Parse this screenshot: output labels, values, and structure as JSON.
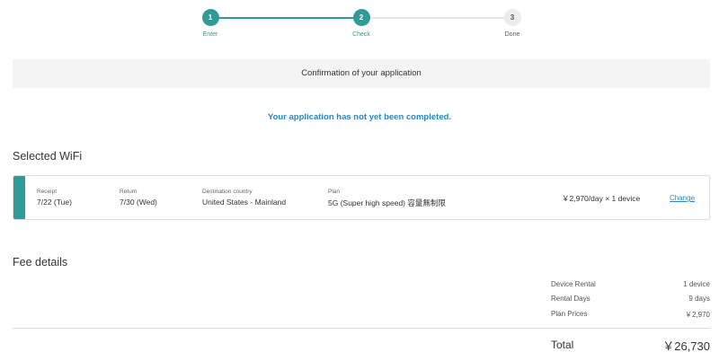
{
  "stepper": {
    "steps": [
      {
        "number": "1",
        "label": "Enter",
        "state": "active"
      },
      {
        "number": "2",
        "label": "Check",
        "state": "active"
      },
      {
        "number": "3",
        "label": "Done",
        "state": "inactive"
      }
    ]
  },
  "banner": {
    "text": "Confirmation of your application"
  },
  "warning": {
    "text": "Your application has not yet been completed."
  },
  "selected_wifi": {
    "title": "Selected WiFi",
    "receipt": {
      "label": "Receipt",
      "value": "7/22 (Tue)"
    },
    "return": {
      "label": "Return",
      "value": "7/30 (Wed)"
    },
    "destination": {
      "label": "Destination country",
      "value": "United States - Mainland"
    },
    "plan": {
      "label": "Plan",
      "value": "5G (Super high speed) 容量無制限"
    },
    "price": "￥2,970/day × 1 device",
    "change_label": "Change"
  },
  "fee_details": {
    "title": "Fee details",
    "rows": [
      {
        "label": "Device Rental",
        "value": "1 device"
      },
      {
        "label": "Rental Days",
        "value": "9 days"
      },
      {
        "label": "Plan Prices",
        "value": "￥2,970"
      }
    ],
    "total_label": "Total",
    "total_value": "￥26,730"
  },
  "colors": {
    "accent": "#2f9b96",
    "link": "#2b87c3"
  }
}
